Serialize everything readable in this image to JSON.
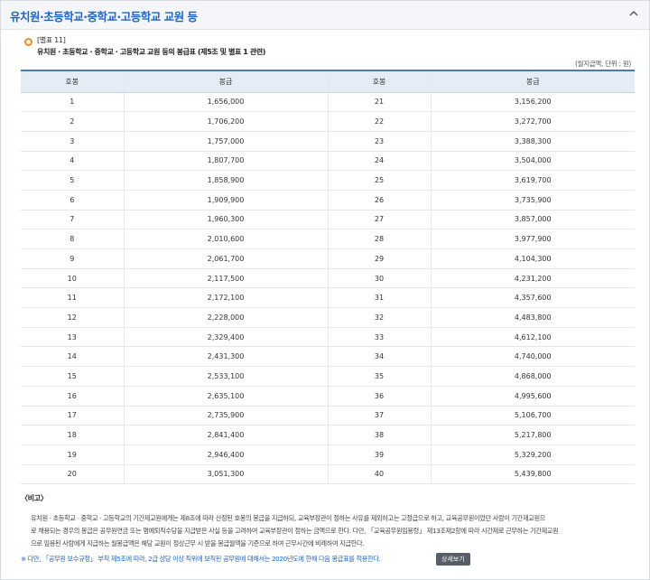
{
  "header": {
    "title": "유치원·초등학교·중학교·고등학교 교원 등",
    "toggle_icon": "chevron-up-icon"
  },
  "section": {
    "label": "[별표 11]",
    "title": "유치원 · 초등학교 · 중학교 · 고등학교 교원 등의 봉급표 (제5조 및 별표 1 관련)",
    "unit": "(월지급액, 단위 : 원)"
  },
  "table": {
    "headers": [
      "호봉",
      "봉급",
      "호봉",
      "봉급"
    ],
    "rows": [
      [
        "1",
        "1,656,000",
        "21",
        "3,156,200"
      ],
      [
        "2",
        "1,706,200",
        "22",
        "3,272,700"
      ],
      [
        "3",
        "1,757,000",
        "23",
        "3,388,300"
      ],
      [
        "4",
        "1,807,700",
        "24",
        "3,504,000"
      ],
      [
        "5",
        "1,858,900",
        "25",
        "3,619,700"
      ],
      [
        "6",
        "1,909,900",
        "26",
        "3,735,900"
      ],
      [
        "7",
        "1,960,300",
        "27",
        "3,857,000"
      ],
      [
        "8",
        "2,010,600",
        "28",
        "3,977,900"
      ],
      [
        "9",
        "2,061,700",
        "29",
        "4,104,300"
      ],
      [
        "10",
        "2,117,500",
        "30",
        "4,231,200"
      ],
      [
        "11",
        "2,172,100",
        "31",
        "4,357,600"
      ],
      [
        "12",
        "2,228,000",
        "32",
        "4,483,800"
      ],
      [
        "13",
        "2,329,400",
        "33",
        "4,612,100"
      ],
      [
        "14",
        "2,431,300",
        "34",
        "4,740,000"
      ],
      [
        "15",
        "2,533,100",
        "35",
        "4,868,000"
      ],
      [
        "16",
        "2,635,100",
        "36",
        "4,995,600"
      ],
      [
        "17",
        "2,735,900",
        "37",
        "5,106,700"
      ],
      [
        "18",
        "2,841,400",
        "38",
        "5,217,800"
      ],
      [
        "19",
        "2,946,400",
        "39",
        "5,329,200"
      ],
      [
        "20",
        "3,051,300",
        "40",
        "5,439,800"
      ]
    ]
  },
  "note": {
    "heading": "〈비고〉",
    "line1": "유치원 · 초등학교 · 중학교 · 고등학교의 기간제교원에게는 제8조에 따라 산정된 호봉의 봉급을 지급하되, 교육부장관이 정하는 사유를 제외하고는 고정급으로 하고, 교육공무원이었던 사람이 기간제교원으",
    "line2": "로 채용되는 경우의 봉급은 공무원연금 또는 명예퇴직수당을 지급받은 사실 등을 고려하여 교육부장관이 정하는 금액으로 한다. 다만, 「교육공무원임용령」 제13조제2항에 따라 시간제로 근무하는 기간제교원",
    "line3": "으로 임용된 사람에게 지급하는 월봉급액은 해당 교원이 정상근무 시 받을 봉급월액을 기준으로 하여 근무시간에 비례하여 지급한다.",
    "footnote": "※ 다만, 「공무원 보수규정」 부칙 제5조에 따라, 2급 상당 이상 직위에 보직된 공무원에 대해서는 2020년도에 한해 다음 봉급표를 적용한다.",
    "detail_button": "상세보기"
  },
  "colors": {
    "accent_blue": "#1f63c4",
    "table_header_bg": "#e6ecf5",
    "section_dot": "#f08a1c",
    "button_bg": "#555d66"
  }
}
